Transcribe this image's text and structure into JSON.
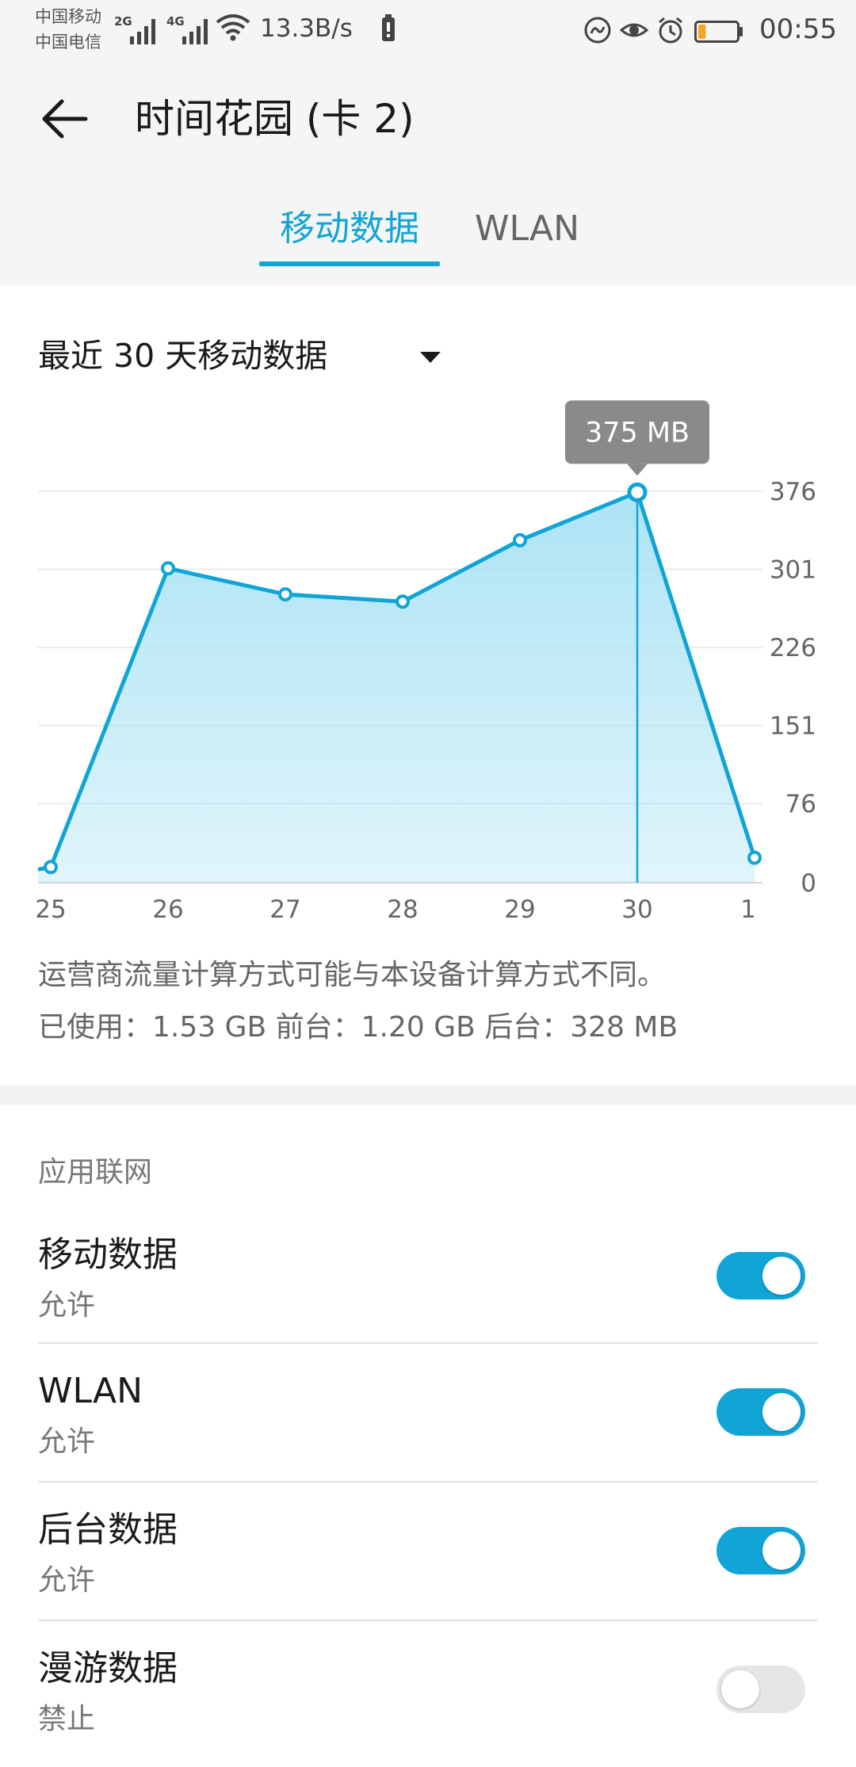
{
  "status_bar": {
    "carrier1": "中国移动",
    "carrier2": "中国电信",
    "net_type1": "2G",
    "net_type2": "4G",
    "speed": "13.3B/s",
    "time": "00:55",
    "icons": [
      "signal-icon",
      "wifi-icon",
      "battery-saver-icon",
      "eye-comfort-icon",
      "alarm-icon",
      "battery-icon"
    ],
    "battery_level": 0.2
  },
  "header": {
    "title": "时间花园 (卡 2)",
    "tabs": [
      {
        "label": "移动数据",
        "active": true
      },
      {
        "label": "WLAN",
        "active": false
      }
    ]
  },
  "period": {
    "label": "最近 30 天移动数据"
  },
  "chart_data": {
    "type": "area",
    "categories": [
      "25",
      "26",
      "27",
      "28",
      "29",
      "30",
      "1"
    ],
    "values": [
      15,
      302,
      277,
      270,
      329,
      375,
      24
    ],
    "y_ticks": [
      "376",
      "301",
      "226",
      "151",
      "76",
      "0"
    ],
    "ylim": [
      0,
      376
    ],
    "selected_index": 5,
    "tooltip": "375 MB",
    "grid": true,
    "line_color": "#10a5d6",
    "fill_color": "#a8e2f4"
  },
  "note": "运营商流量计算方式可能与本设备计算方式不同。",
  "usage": "已使用：1.53 GB 前台：1.20 GB 后台：328 MB",
  "network": {
    "section_title": "应用联网",
    "items": [
      {
        "title": "移动数据",
        "status": "允许",
        "enabled": true
      },
      {
        "title": "WLAN",
        "status": "允许",
        "enabled": true
      },
      {
        "title": "后台数据",
        "status": "允许",
        "enabled": true
      },
      {
        "title": "漫游数据",
        "status": "禁止",
        "enabled": false
      }
    ]
  },
  "colors": {
    "accent": "#10a5d6",
    "toggle_off": "#e6e6e6"
  }
}
